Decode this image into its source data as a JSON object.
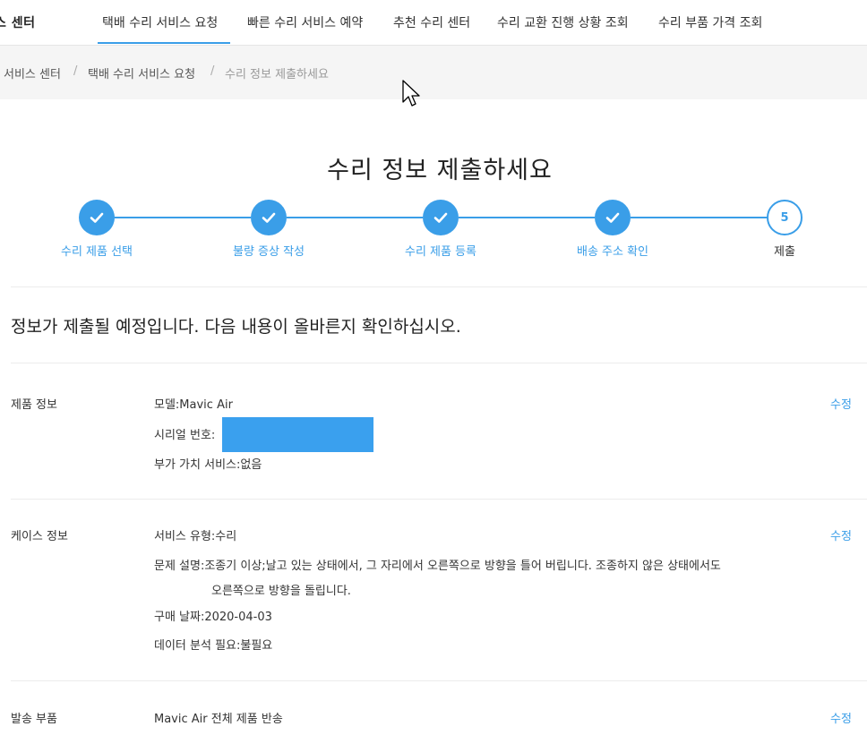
{
  "nav": {
    "brand": "스 센터",
    "items": [
      "택배 수리 서비스 요청",
      "빠른 수리 서비스 예약",
      "추천 수리 센터",
      "수리 교환 진행 상황 조회",
      "수리 부품 가격 조회"
    ]
  },
  "breadcrumb": {
    "items": [
      "서비스 센터",
      "택배 수리 서비스 요청",
      "수리 정보 제출하세요"
    ],
    "separator": "/"
  },
  "page": {
    "title": "수리 정보 제출하세요",
    "intro": "정보가 제출될 예정입니다. 다음 내용이 올바른지 확인하십시오."
  },
  "steps": [
    {
      "label": "수리 제품 선택",
      "done": true
    },
    {
      "label": "불량 증상 작성",
      "done": true
    },
    {
      "label": "수리 제품 등록",
      "done": true
    },
    {
      "label": "배송 주소 확인",
      "done": true
    },
    {
      "label": "제출",
      "number": "5",
      "done": false
    }
  ],
  "sections": {
    "product": {
      "label": "제품 정보",
      "model": "모델:Mavic Air",
      "serial": "시리얼 번호:",
      "vas": "부가 가치 서비스:없음",
      "edit": "수정"
    },
    "case": {
      "label": "케이스 정보",
      "service_type": "서비스 유형:수리",
      "desc_line1": "문제 설명:조종기 이상;날고 있는 상태에서, 그 자리에서 오른쪽으로 방향을 틀어 버립니다. 조종하지 않은 상태에서도",
      "desc_line2": "오른쪽으로 방향을 돌립니다.",
      "purchase_date": "구매 날짜:2020-04-03",
      "data_analysis": "데이터 분석 필요:불필요",
      "edit": "수정"
    },
    "shipping": {
      "label": "발송 부품",
      "value": "Mavic Air 전체 제품 반송",
      "edit": "수정"
    }
  },
  "colors": {
    "accent": "#3a9ee8",
    "redaction": "#3aa0ee"
  }
}
